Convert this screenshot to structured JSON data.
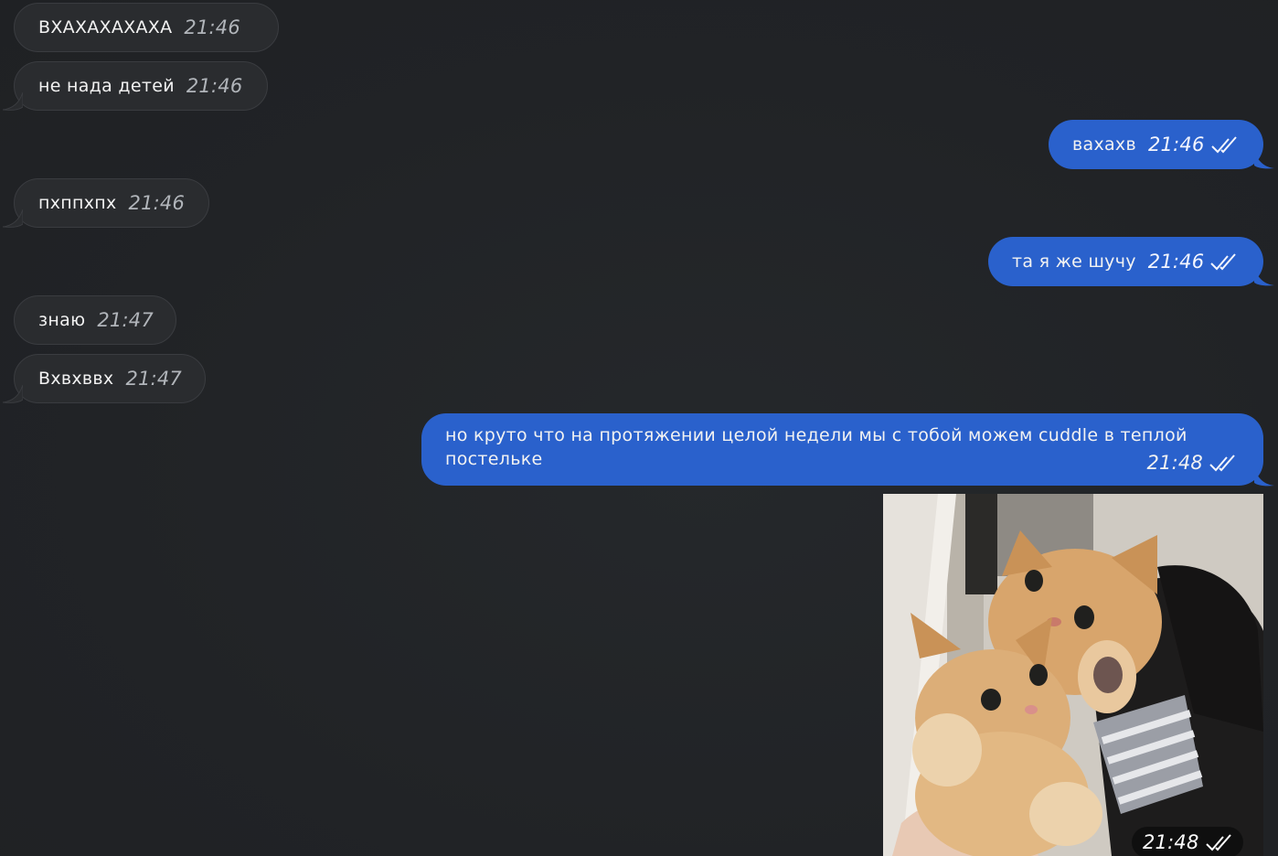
{
  "messages": [
    {
      "dir": "in",
      "text": "ВХАХАХАХАХА",
      "time": "21:46"
    },
    {
      "dir": "in",
      "text": "не нада детей",
      "time": "21:46"
    },
    {
      "dir": "out",
      "text": "вахахв",
      "time": "21:46",
      "read": true
    },
    {
      "dir": "in",
      "text": "пхппхпх",
      "time": "21:46"
    },
    {
      "dir": "out",
      "text": "та я же шучу",
      "time": "21:46",
      "read": true
    },
    {
      "dir": "in",
      "text": "знаю",
      "time": "21:47"
    },
    {
      "dir": "in",
      "text": "Вхвхввх",
      "time": "21:47"
    },
    {
      "dir": "out",
      "text": "но круто что на протяжении целой недели мы с тобой можем cuddle  в теплой постельке",
      "time": "21:48",
      "read": true
    },
    {
      "dir": "out",
      "type": "photo",
      "photo_subject": "two cats cuddling",
      "time": "21:48",
      "read": true
    }
  ],
  "colors": {
    "background": "#212326",
    "incoming_bubble": "#2a2c2f",
    "outgoing_bubble": "#2a61cc"
  }
}
